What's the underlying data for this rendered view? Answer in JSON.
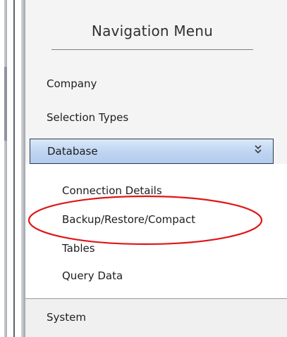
{
  "navigation": {
    "title": "Navigation Menu",
    "items": [
      {
        "label": "Company"
      },
      {
        "label": "Selection Types"
      }
    ],
    "database": {
      "label": "Database",
      "expanded": true,
      "icon": "chevron-double-down-icon",
      "children": [
        {
          "label": "Connection Details"
        },
        {
          "label": "Backup/Restore/Compact"
        },
        {
          "label": "Tables"
        },
        {
          "label": "Query Data"
        }
      ]
    },
    "system": {
      "label": "System"
    }
  },
  "annotation": {
    "shape": "ellipse",
    "color": "#e01515",
    "target": "Backup/Restore/Compact"
  },
  "colors": {
    "header_gradient_top": "#dbe9fb",
    "header_gradient_bottom": "#b3ccee",
    "header_border": "#2f3a4c",
    "panel_background": "#f4f4f4"
  }
}
